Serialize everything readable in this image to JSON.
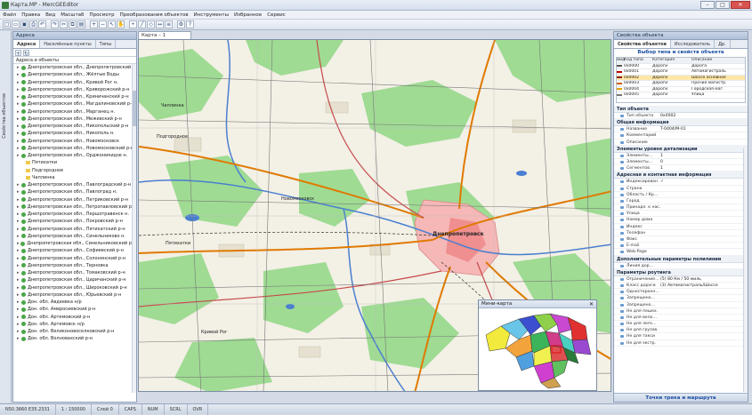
{
  "window": {
    "title": "Карта.MP - MercGEEditor",
    "min": "–",
    "max": "□",
    "close": "✕"
  },
  "menu": [
    "Файл",
    "Правка",
    "Вид",
    "Масштаб",
    "Просмотр",
    "Преобразования объектов",
    "Инструменты",
    "Избранное",
    "Сервис"
  ],
  "toolbar_icons": [
    "new",
    "open",
    "save",
    "print",
    "undo",
    "redo",
    "cut",
    "copy",
    "paste",
    "zoom-in",
    "zoom-out",
    "select",
    "pan",
    "draw-point",
    "draw-line",
    "draw-polygon",
    "measure",
    "layers",
    "settings",
    "help"
  ],
  "doc_tab": "Карта – 1",
  "left_panel": {
    "title": "Адреса",
    "side_label": "Свойства объектов",
    "tabs": [
      "Адреса",
      "Населённые пункты",
      "Типы"
    ],
    "column_header": "Адреса и объекты",
    "rows": [
      {
        "text": "Днепропетровская обл., Днепропетровский",
        "kind": "node"
      },
      {
        "text": "Днепропетровская обл., Жёлтые Воды",
        "kind": "node"
      },
      {
        "text": "Днепропетровская обл., Кривой Рог н.",
        "kind": "node"
      },
      {
        "text": "Днепропетровская обл., Криворожский р-н",
        "kind": "node"
      },
      {
        "text": "Днепропетровская обл., Криничанский р-н",
        "kind": "node"
      },
      {
        "text": "Днепропетровская обл., Магдалиновский р-н",
        "kind": "node"
      },
      {
        "text": "Днепропетровская обл., Марганец н.",
        "kind": "node"
      },
      {
        "text": "Днепропетровская обл., Межевский р-н",
        "kind": "node"
      },
      {
        "text": "Днепропетровская обл., Никопольский р-н",
        "kind": "node"
      },
      {
        "text": "Днепропетровская обл., Никополь н.",
        "kind": "node"
      },
      {
        "text": "Днепропетровская обл., Новомосковск",
        "kind": "node"
      },
      {
        "text": "Днепропетровская обл., Новомосковский р-н",
        "kind": "node"
      },
      {
        "text": "Днепропетровская обл., Орджоникидзе н.",
        "kind": "node"
      },
      {
        "text": "Пятихатки",
        "kind": "leaf"
      },
      {
        "text": "Подгородное",
        "kind": "leaf"
      },
      {
        "text": "Чаплинка",
        "kind": "leaf"
      },
      {
        "text": "Днепропетровская обл., Павлоградский р-н",
        "kind": "node"
      },
      {
        "text": "Днепропетровская обл., Павлоград н.",
        "kind": "node"
      },
      {
        "text": "Днепропетровская обл., Петриковский р-н",
        "kind": "node"
      },
      {
        "text": "Днепропетровская обл., Петропавловский р-н",
        "kind": "node"
      },
      {
        "text": "Днепропетровская обл., Першотравенск н.",
        "kind": "node"
      },
      {
        "text": "Днепропетровская обл., Покровский р-н",
        "kind": "node"
      },
      {
        "text": "Днепропетровская обл., Пятихатский р-н",
        "kind": "node"
      },
      {
        "text": "Днепропетровская обл., Синельниково н.",
        "kind": "node"
      },
      {
        "text": "Днепропетровская обл., Синельниковский р-н",
        "kind": "node"
      },
      {
        "text": "Днепропетровская обл., Софиевский р-н",
        "kind": "node"
      },
      {
        "text": "Днепропетровская обл., Солонянский р-н",
        "kind": "node"
      },
      {
        "text": "Днепропетровская обл., Терновка",
        "kind": "node"
      },
      {
        "text": "Днепропетровская обл., Томаковский р-н",
        "kind": "node"
      },
      {
        "text": "Днепропетровская обл., Царичанский р-н",
        "kind": "node"
      },
      {
        "text": "Днепропетровская обл., Широковский р-н",
        "kind": "node"
      },
      {
        "text": "Днепропетровская обл., Юрьевский р-н",
        "kind": "node"
      },
      {
        "text": "Дон. обл. Авдеевка н/р",
        "kind": "node"
      },
      {
        "text": "Дон. обл. Амвросиевский р-н",
        "kind": "node"
      },
      {
        "text": "Дон. обл. Артемовский р-н",
        "kind": "node"
      },
      {
        "text": "Дон. обл. Артемовск н/р",
        "kind": "node"
      },
      {
        "text": "Дон. обл. Великоновоселковский р-н",
        "kind": "node"
      },
      {
        "text": "Дон. обл. Волновахский р-н",
        "kind": "node"
      }
    ]
  },
  "map_labels": [
    {
      "name": "Чаплинка"
    },
    {
      "name": "Подгородное"
    },
    {
      "name": "Новомосковск"
    },
    {
      "name": "Днепропетровск"
    },
    {
      "name": "Пятихатки"
    },
    {
      "name": "Кривой Рог"
    }
  ],
  "minimap": {
    "title": "Мини-карта",
    "close": "✕"
  },
  "right_panel": {
    "title": "Свойства объекта",
    "tabs": [
      "Свойства объектов",
      "Исследователь",
      "Др."
    ],
    "type_title": "Выбор типа и свойств объекта",
    "type_headers": [
      "Вид",
      "Код типа",
      "Категория",
      "Описание"
    ],
    "type_rows": [
      {
        "color": "#555555",
        "code": "0x0000",
        "cat": "Дороги",
        "desc": "Дорога",
        "selected": false
      },
      {
        "color": "#c00000",
        "code": "0x0001",
        "cat": "Дороги",
        "desc": "Автомагистраль",
        "selected": false
      },
      {
        "color": "#8b1a1a",
        "code": "0x0002",
        "cat": "Дороги",
        "desc": "Шоссе основное",
        "selected": true
      },
      {
        "color": "#d06000",
        "code": "0x0003",
        "cat": "Дороги",
        "desc": "Прочие магистр.",
        "selected": false
      },
      {
        "color": "#e6a000",
        "code": "0x0004",
        "cat": "Дороги",
        "desc": "Городская маг.",
        "selected": false
      },
      {
        "color": "#777777",
        "code": "0x0005",
        "cat": "Дороги",
        "desc": "Улица",
        "selected": false
      }
    ],
    "groups": [
      {
        "name": "Тип объекта",
        "rows": [
          {
            "n": "Тип объекта",
            "v": "0x0002"
          }
        ]
      },
      {
        "name": "Общая информация",
        "rows": [
          {
            "n": "Название",
            "v": "T-0404/M-01"
          },
          {
            "n": "Комментарий",
            "v": ""
          },
          {
            "n": "Описание",
            "v": ""
          }
        ]
      },
      {
        "name": "Элементы уровня детализации",
        "rows": [
          {
            "n": "Элементы…",
            "v": "1"
          },
          {
            "n": "Элементы…",
            "v": "0"
          },
          {
            "n": "Сегментов",
            "v": "1"
          }
        ]
      },
      {
        "name": "Адресная и контактная информация",
        "rows": [
          {
            "n": "Индексирован",
            "v": "✓"
          },
          {
            "n": "Страна",
            "v": ""
          },
          {
            "n": "Область / Кр…",
            "v": ""
          },
          {
            "n": "Город",
            "v": ""
          },
          {
            "n": "Принадл. к нас.",
            "v": ""
          },
          {
            "n": "Улица",
            "v": ""
          },
          {
            "n": "Номер дома",
            "v": ""
          },
          {
            "n": "Индекс",
            "v": ""
          },
          {
            "n": "Телефон",
            "v": ""
          },
          {
            "n": "Факс",
            "v": ""
          },
          {
            "n": "E-mail",
            "v": ""
          },
          {
            "n": "Web-Page",
            "v": ""
          }
        ]
      },
      {
        "name": "Дополнительные параметры полилинии",
        "rows": [
          {
            "n": "Линия дор…",
            "v": ""
          }
        ]
      },
      {
        "name": "Параметры роутинга",
        "rows": [
          {
            "n": "Ограничение…",
            "v": "(5) 80 Км / 50 миль"
          },
          {
            "n": "Класс дороги",
            "v": "(3) Автомагистраль/Шоссе"
          },
          {
            "n": "Односторонн…",
            "v": ""
          },
          {
            "n": "Запрещено…",
            "v": ""
          },
          {
            "n": "Запрещено…",
            "v": ""
          },
          {
            "n": "Не для пешех.",
            "v": ""
          },
          {
            "n": "Не для вело…",
            "v": ""
          },
          {
            "n": "Не для легк…",
            "v": ""
          },
          {
            "n": "Не для грузов.",
            "v": ""
          },
          {
            "n": "Не для такси",
            "v": ""
          },
          {
            "n": "Не для экстр.",
            "v": ""
          }
        ]
      }
    ],
    "bottom_label": "Точки трека и маршрута"
  },
  "status": [
    "N50.3660 E35.2331",
    "1 : 150000",
    "Слой 0",
    "CAPS",
    "NUM",
    "SCRL",
    "OVR"
  ]
}
